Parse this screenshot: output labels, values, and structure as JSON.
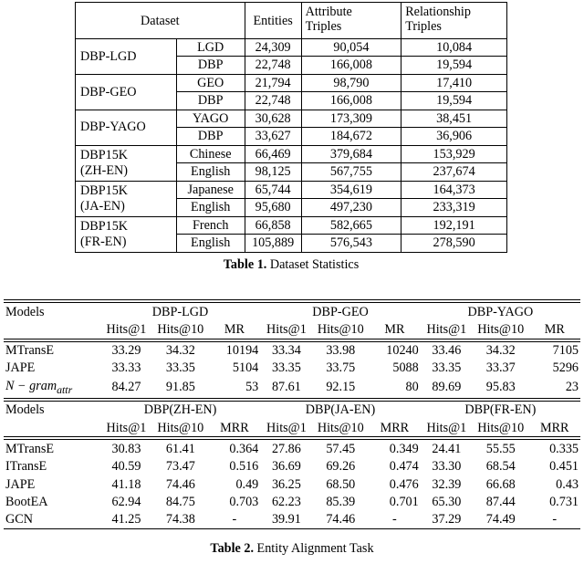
{
  "table1": {
    "headers": {
      "dataset": "Dataset",
      "entities": "Entities",
      "attribute_triples_l1": "Attribute",
      "attribute_triples_l2": "Triples",
      "relationship_triples_l1": "Relationship",
      "relationship_triples_l2": "Triples"
    },
    "rows": [
      {
        "name_l1": "DBP-LGD",
        "name_l2": "",
        "subs": [
          "LGD",
          "DBP"
        ],
        "entities": [
          "24,309",
          "22,748"
        ],
        "attribute": [
          "90,054",
          "166,008"
        ],
        "relationship": [
          "10,084",
          "19,594"
        ]
      },
      {
        "name_l1": "DBP-GEO",
        "name_l2": "",
        "subs": [
          "GEO",
          "DBP"
        ],
        "entities": [
          "21,794",
          "22,748"
        ],
        "attribute": [
          "98,790",
          "166,008"
        ],
        "relationship": [
          "17,410",
          "19,594"
        ]
      },
      {
        "name_l1": "DBP-YAGO",
        "name_l2": "",
        "subs": [
          "YAGO",
          "DBP"
        ],
        "entities": [
          "30,628",
          "33,627"
        ],
        "attribute": [
          "173,309",
          "184,672"
        ],
        "relationship": [
          "38,451",
          "36,906"
        ]
      },
      {
        "name_l1": "DBP15K",
        "name_l2": "(ZH-EN)",
        "subs": [
          "Chinese",
          "English"
        ],
        "entities": [
          "66,469",
          "98,125"
        ],
        "attribute": [
          "379,684",
          "567,755"
        ],
        "relationship": [
          "153,929",
          "237,674"
        ]
      },
      {
        "name_l1": "DBP15K",
        "name_l2": "(JA-EN)",
        "subs": [
          "Japanese",
          "English"
        ],
        "entities": [
          "65,744",
          "95,680"
        ],
        "attribute": [
          "354,619",
          "497,230"
        ],
        "relationship": [
          "164,373",
          "233,319"
        ]
      },
      {
        "name_l1": "DBP15K",
        "name_l2": "(FR-EN)",
        "subs": [
          "French",
          "English"
        ],
        "entities": [
          "66,858",
          "105,889"
        ],
        "attribute": [
          "582,665",
          "576,543"
        ],
        "relationship": [
          "192,191",
          "278,590"
        ]
      }
    ],
    "caption_label": "Table 1.",
    "caption_text": "Dataset Statistics"
  },
  "table2": {
    "caption_label": "Table 2.",
    "caption_text": "Entity Alignment Task",
    "section_a": {
      "models_header": "Models",
      "groups": [
        "DBP-LGD",
        "DBP-GEO",
        "DBP-YAGO"
      ],
      "metrics": [
        "Hits@1",
        "Hits@10",
        "MR"
      ],
      "rows": [
        {
          "model": "MTransE",
          "model_is_math": false,
          "values": [
            "33.29",
            "34.32",
            "10194",
            "33.34",
            "33.98",
            "10240",
            "33.46",
            "34.32",
            "7105"
          ]
        },
        {
          "model": "JAPE",
          "model_is_math": false,
          "values": [
            "33.33",
            "33.35",
            "5104",
            "33.35",
            "33.75",
            "5088",
            "33.35",
            "33.37",
            "5296"
          ]
        },
        {
          "model": "N − gram",
          "model_is_math": true,
          "model_sub": "attr",
          "values": [
            "84.27",
            "91.85",
            "53",
            "87.61",
            "92.15",
            "80",
            "89.69",
            "95.83",
            "23"
          ]
        }
      ]
    },
    "section_b": {
      "models_header": "Models",
      "groups": [
        "DBP(ZH-EN)",
        "DBP(JA-EN)",
        "DBP(FR-EN)"
      ],
      "metrics": [
        "Hits@1",
        "Hits@10",
        "MRR"
      ],
      "rows": [
        {
          "model": "MTransE",
          "values": [
            "30.83",
            "61.41",
            "0.364",
            "27.86",
            "57.45",
            "0.349",
            "24.41",
            "55.55",
            "0.335"
          ]
        },
        {
          "model": "ITransE",
          "values": [
            "40.59",
            "73.47",
            "0.516",
            "36.69",
            "69.26",
            "0.474",
            "33.30",
            "68.54",
            "0.451"
          ]
        },
        {
          "model": "JAPE",
          "values": [
            "41.18",
            "74.46",
            "0.49",
            "36.25",
            "68.50",
            "0.476",
            "32.39",
            "66.68",
            "0.43"
          ]
        },
        {
          "model": "BootEA",
          "values": [
            "62.94",
            "84.75",
            "0.703",
            "62.23",
            "85.39",
            "0.701",
            "65.30",
            "87.44",
            "0.731"
          ]
        },
        {
          "model": "GCN",
          "values": [
            "41.25",
            "74.38",
            "-",
            "39.91",
            "74.46",
            "-",
            "37.29",
            "74.49",
            "-"
          ]
        }
      ]
    }
  }
}
